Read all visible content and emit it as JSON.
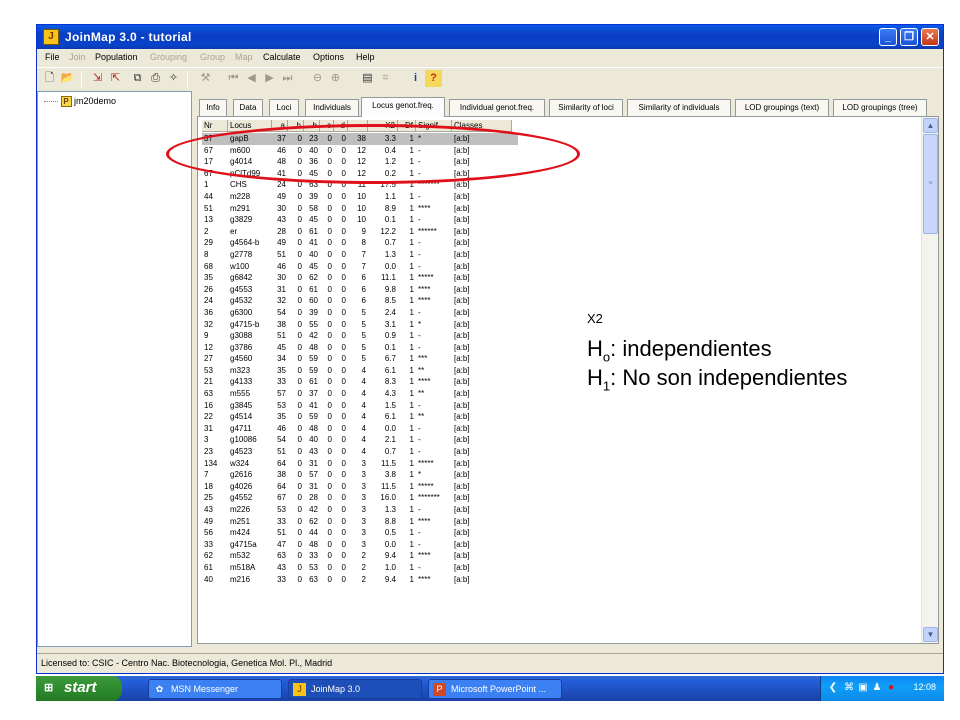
{
  "window": {
    "title": "JoinMap 3.0  -  tutorial",
    "min": "_",
    "max": "❐",
    "close": "✕",
    "app_icon": "J"
  },
  "menu": [
    {
      "label": "File",
      "enabled": true
    },
    {
      "label": "Join",
      "enabled": false
    },
    {
      "label": "Population",
      "enabled": true
    },
    {
      "label": "Grouping",
      "enabled": false
    },
    {
      "label": "Group",
      "enabled": false
    },
    {
      "label": "Map",
      "enabled": false
    },
    {
      "label": "Calculate",
      "enabled": true
    },
    {
      "label": "Options",
      "enabled": true
    },
    {
      "label": "Help",
      "enabled": true
    }
  ],
  "toolbar_icons": [
    "new-file-icon",
    "open-folder-icon",
    "import-icon",
    "export-icon",
    "copy-icon",
    "print-icon",
    "tools-icon",
    "settings-icon",
    "first-icon",
    "previous-icon",
    "next-icon",
    "last-icon",
    "zoom-out-icon",
    "zoom-in-icon",
    "calculator-icon",
    "grid-icon",
    "info-icon",
    "help-icon"
  ],
  "tree": {
    "node_label": "jm20demo",
    "icon": "P"
  },
  "tabs": [
    {
      "label": "Info",
      "active": false
    },
    {
      "label": "Data",
      "active": false
    },
    {
      "label": "Loci",
      "active": false
    },
    {
      "label": "Individuals",
      "active": false
    },
    {
      "label": "Locus genot.freq.",
      "active": true
    },
    {
      "label": "Individual genot.freq.",
      "active": false
    },
    {
      "label": "Similarity of loci",
      "active": false
    },
    {
      "label": "Similarity of individuals",
      "active": false
    },
    {
      "label": "LOD groupings (text)",
      "active": false
    },
    {
      "label": "LOD groupings (tree)",
      "active": false
    }
  ],
  "grid": {
    "columns": [
      "Nr",
      "Locus",
      "a",
      "h",
      "b",
      "c",
      "d",
      "-",
      "X2",
      "Df",
      "Signif.",
      "Classes"
    ],
    "selected_row": 0,
    "rows": [
      [
        "37",
        "gapB",
        "37",
        "0",
        "23",
        "0",
        "0",
        "38",
        "3.3",
        "1",
        "*",
        "[a:b]"
      ],
      [
        "67",
        "m600",
        "46",
        "0",
        "40",
        "0",
        "0",
        "12",
        "0.4",
        "1",
        "-",
        "[a:b]"
      ],
      [
        "17",
        "g4014",
        "48",
        "0",
        "36",
        "0",
        "0",
        "12",
        "1.2",
        "1",
        "-",
        "[a:b]"
      ],
      [
        "67",
        "pClTd99",
        "41",
        "0",
        "45",
        "0",
        "0",
        "12",
        "0.2",
        "1",
        "-",
        "[a:b]"
      ],
      [
        "1",
        "CHS",
        "24",
        "0",
        "63",
        "0",
        "0",
        "11",
        "17.5",
        "1",
        "*******",
        "[a:b]"
      ],
      [
        "44",
        "m228",
        "49",
        "0",
        "39",
        "0",
        "0",
        "10",
        "1.1",
        "1",
        "-",
        "[a:b]"
      ],
      [
        "51",
        "m291",
        "30",
        "0",
        "58",
        "0",
        "0",
        "10",
        "8.9",
        "1",
        "****",
        "[a:b]"
      ],
      [
        "13",
        "g3829",
        "43",
        "0",
        "45",
        "0",
        "0",
        "10",
        "0.1",
        "1",
        "-",
        "[a:b]"
      ],
      [
        "2",
        "er",
        "28",
        "0",
        "61",
        "0",
        "0",
        "9",
        "12.2",
        "1",
        "******",
        "[a:b]"
      ],
      [
        "29",
        "g4564-b",
        "49",
        "0",
        "41",
        "0",
        "0",
        "8",
        "0.7",
        "1",
        "-",
        "[a:b]"
      ],
      [
        "8",
        "g2778",
        "51",
        "0",
        "40",
        "0",
        "0",
        "7",
        "1.3",
        "1",
        "-",
        "[a:b]"
      ],
      [
        "68",
        "w100",
        "46",
        "0",
        "45",
        "0",
        "0",
        "7",
        "0.0",
        "1",
        "-",
        "[a:b]"
      ],
      [
        "35",
        "g6842",
        "30",
        "0",
        "62",
        "0",
        "0",
        "6",
        "11.1",
        "1",
        "*****",
        "[a:b]"
      ],
      [
        "26",
        "g4553",
        "31",
        "0",
        "61",
        "0",
        "0",
        "6",
        "9.8",
        "1",
        "****",
        "[a:b]"
      ],
      [
        "24",
        "g4532",
        "32",
        "0",
        "60",
        "0",
        "0",
        "6",
        "8.5",
        "1",
        "****",
        "[a:b]"
      ],
      [
        "36",
        "g6300",
        "54",
        "0",
        "39",
        "0",
        "0",
        "5",
        "2.4",
        "1",
        "-",
        "[a:b]"
      ],
      [
        "32",
        "g4715-b",
        "38",
        "0",
        "55",
        "0",
        "0",
        "5",
        "3.1",
        "1",
        "*",
        "[a:b]"
      ],
      [
        "9",
        "g3088",
        "51",
        "0",
        "42",
        "0",
        "0",
        "5",
        "0.9",
        "1",
        "-",
        "[a:b]"
      ],
      [
        "12",
        "g3786",
        "45",
        "0",
        "48",
        "0",
        "0",
        "5",
        "0.1",
        "1",
        "-",
        "[a:b]"
      ],
      [
        "27",
        "g4560",
        "34",
        "0",
        "59",
        "0",
        "0",
        "5",
        "6.7",
        "1",
        "***",
        "[a:b]"
      ],
      [
        "53",
        "m323",
        "35",
        "0",
        "59",
        "0",
        "0",
        "4",
        "6.1",
        "1",
        "**",
        "[a:b]"
      ],
      [
        "21",
        "g4133",
        "33",
        "0",
        "61",
        "0",
        "0",
        "4",
        "8.3",
        "1",
        "****",
        "[a:b]"
      ],
      [
        "63",
        "m555",
        "57",
        "0",
        "37",
        "0",
        "0",
        "4",
        "4.3",
        "1",
        "**",
        "[a:b]"
      ],
      [
        "16",
        "g3845",
        "53",
        "0",
        "41",
        "0",
        "0",
        "4",
        "1.5",
        "1",
        "-",
        "[a:b]"
      ],
      [
        "22",
        "g4514",
        "35",
        "0",
        "59",
        "0",
        "0",
        "4",
        "6.1",
        "1",
        "**",
        "[a:b]"
      ],
      [
        "31",
        "g4711",
        "46",
        "0",
        "48",
        "0",
        "0",
        "4",
        "0.0",
        "1",
        "-",
        "[a:b]"
      ],
      [
        "3",
        "g10086",
        "54",
        "0",
        "40",
        "0",
        "0",
        "4",
        "2.1",
        "1",
        "-",
        "[a:b]"
      ],
      [
        "23",
        "g4523",
        "51",
        "0",
        "43",
        "0",
        "0",
        "4",
        "0.7",
        "1",
        "-",
        "[a:b]"
      ],
      [
        "134",
        "w324",
        "64",
        "0",
        "31",
        "0",
        "0",
        "3",
        "11.5",
        "1",
        "*****",
        "[a:b]"
      ],
      [
        "7",
        "g2616",
        "38",
        "0",
        "57",
        "0",
        "0",
        "3",
        "3.8",
        "1",
        "*",
        "[a:b]"
      ],
      [
        "18",
        "g4026",
        "64",
        "0",
        "31",
        "0",
        "0",
        "3",
        "11.5",
        "1",
        "*****",
        "[a:b]"
      ],
      [
        "25",
        "g4552",
        "67",
        "0",
        "28",
        "0",
        "0",
        "3",
        "16.0",
        "1",
        "*******",
        "[a:b]"
      ],
      [
        "43",
        "m226",
        "53",
        "0",
        "42",
        "0",
        "0",
        "3",
        "1.3",
        "1",
        "-",
        "[a:b]"
      ],
      [
        "49",
        "m251",
        "33",
        "0",
        "62",
        "0",
        "0",
        "3",
        "8.8",
        "1",
        "****",
        "[a:b]"
      ],
      [
        "56",
        "m424",
        "51",
        "0",
        "44",
        "0",
        "0",
        "3",
        "0.5",
        "1",
        "-",
        "[a:b]"
      ],
      [
        "33",
        "g4715a",
        "47",
        "0",
        "48",
        "0",
        "0",
        "3",
        "0.0",
        "1",
        "-",
        "[a:b]"
      ],
      [
        "62",
        "m532",
        "63",
        "0",
        "33",
        "0",
        "0",
        "2",
        "9.4",
        "1",
        "****",
        "[a:b]"
      ],
      [
        "61",
        "m518A",
        "43",
        "0",
        "53",
        "0",
        "0",
        "2",
        "1.0",
        "1",
        "-",
        "[a:b]"
      ],
      [
        "40",
        "m216",
        "33",
        "0",
        "63",
        "0",
        "0",
        "2",
        "9.4",
        "1",
        "****",
        "[a:b]"
      ]
    ]
  },
  "annotation": {
    "x2_label": "X2",
    "h0_prefix": "H",
    "h0_sub": "o",
    "h0_text": ": independientes",
    "h1_prefix": "H",
    "h1_sub": "1",
    "h1_text": ": No son independientes",
    "highlight_color": "#e0101a"
  },
  "status": {
    "text": "Licensed to: CSIC - Centro Nac. Biotecnologia, Genetica Mol. Pl., Madrid"
  },
  "taskbar": {
    "start_label": "start",
    "tasks": [
      {
        "label": "MSN Messenger",
        "icon": "msn-icon",
        "glyph": "✿",
        "active": false
      },
      {
        "label": "JoinMap 3.0",
        "icon": "joinmap-icon",
        "glyph": "J",
        "active": true
      },
      {
        "label": "Microsoft PowerPoint ...",
        "icon": "powerpoint-icon",
        "glyph": "P",
        "active": false
      }
    ],
    "clock": "12:08"
  }
}
